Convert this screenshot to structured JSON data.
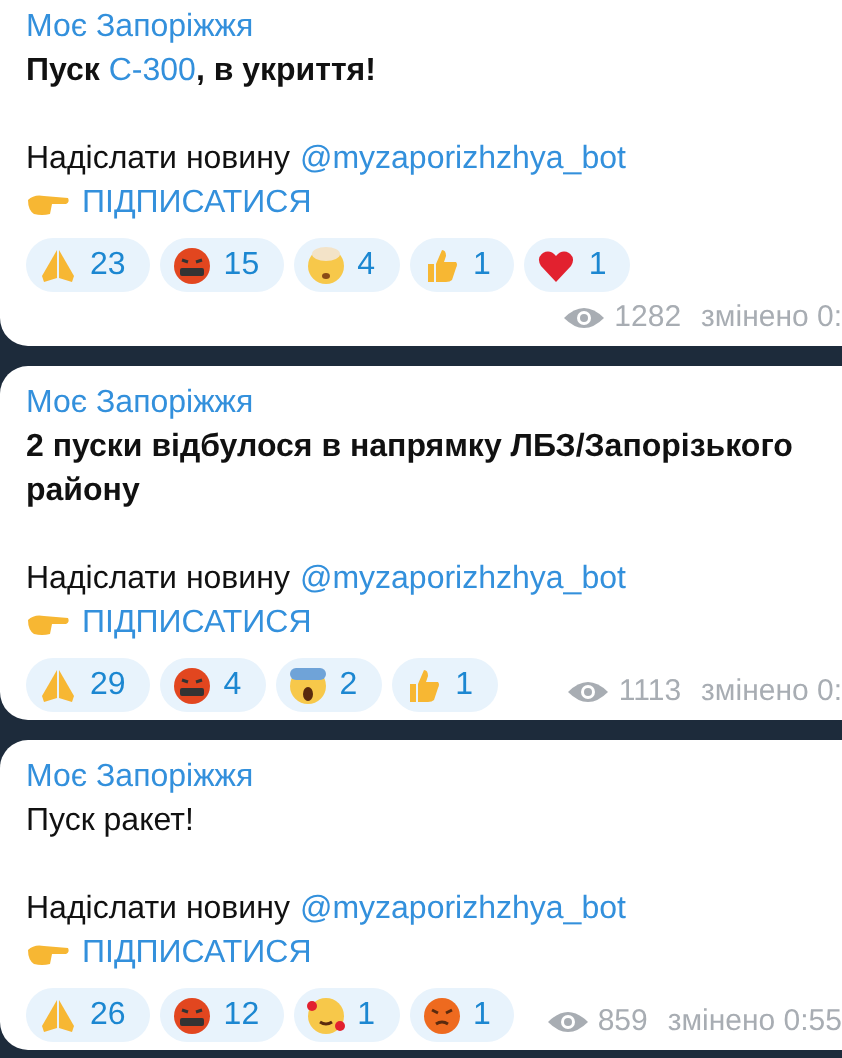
{
  "messages": [
    {
      "channel": "Моє Запоріжжя",
      "bold": true,
      "body": [
        {
          "text": "Пуск "
        },
        {
          "text": "С-300",
          "kind": "link"
        },
        {
          "text": ", в укриття!"
        }
      ],
      "send_news": "Надіслати новину",
      "bot_link": "@myzaporizhzhya_bot",
      "subscribe": "ПІДПИСАТИСЯ",
      "reactions": [
        {
          "kind": "pray",
          "count": "23"
        },
        {
          "kind": "cursing",
          "count": "15"
        },
        {
          "kind": "exploding",
          "count": "4"
        },
        {
          "kind": "thumbs",
          "count": "1"
        },
        {
          "kind": "heart",
          "count": "1"
        }
      ],
      "views": "1282",
      "edited": "змінено 0:"
    },
    {
      "channel": "Моє Запоріжжя",
      "bold": true,
      "body": [
        {
          "text": "2 пуски відбулося в напрямку ЛБЗ/Запорізького району"
        }
      ],
      "send_news": "Надіслати новину",
      "bot_link": "@myzaporizhzhya_bot",
      "subscribe": "ПІДПИСАТИСЯ",
      "reactions": [
        {
          "kind": "pray",
          "count": "29"
        },
        {
          "kind": "cursing",
          "count": "4"
        },
        {
          "kind": "scream",
          "count": "2"
        },
        {
          "kind": "thumbs",
          "count": "1"
        }
      ],
      "views": "1113",
      "edited": "змінено 0:"
    },
    {
      "channel": "Моє Запоріжжя",
      "bold": false,
      "body": [
        {
          "text": "Пуск ракет!"
        }
      ],
      "send_news": "Надіслати новину",
      "bot_link": "@myzaporizhzhya_bot",
      "subscribe": "ПІДПИСАТИСЯ",
      "reactions": [
        {
          "kind": "pray",
          "count": "26"
        },
        {
          "kind": "cursing",
          "count": "12"
        },
        {
          "kind": "hearts",
          "count": "1"
        },
        {
          "kind": "angry",
          "count": "1"
        }
      ],
      "views": "859",
      "edited": "змінено 0:55"
    }
  ]
}
